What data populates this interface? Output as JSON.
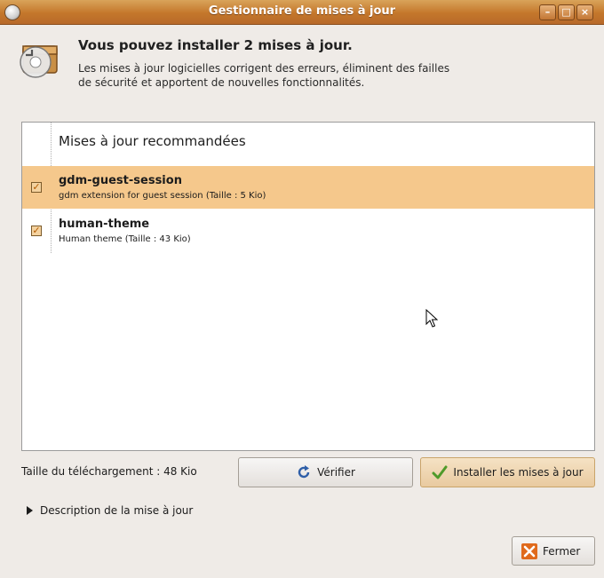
{
  "window": {
    "title": "Gestionnaire de mises à jour"
  },
  "header": {
    "icon": "update-manager-icon",
    "title": "Vous pouvez installer 2 mises à jour.",
    "description": "Les mises à jour logicielles corrigent des erreurs, éliminent des failles de sécurité et apportent de nouvelles fonctionnalités."
  },
  "list": {
    "section_title": "Mises à jour recommandées",
    "items": [
      {
        "name": "gdm-guest-session",
        "description": "gdm extension for guest session (Taille : 5 Kio)",
        "checked": true,
        "selected": true
      },
      {
        "name": "human-theme",
        "description": "Human theme (Taille : 43 Kio)",
        "checked": true,
        "selected": false
      }
    ]
  },
  "footer": {
    "download_size": "Taille du téléchargement : 48 Kio",
    "check_button": "Vérifier",
    "install_button": "Installer les mises à jour",
    "description_toggle": "Description de la mise à jour",
    "close_button": "Fermer"
  },
  "colors": {
    "titlebar": "#c4772b",
    "selection": "#f5c88c",
    "window_bg": "#efebe7"
  }
}
